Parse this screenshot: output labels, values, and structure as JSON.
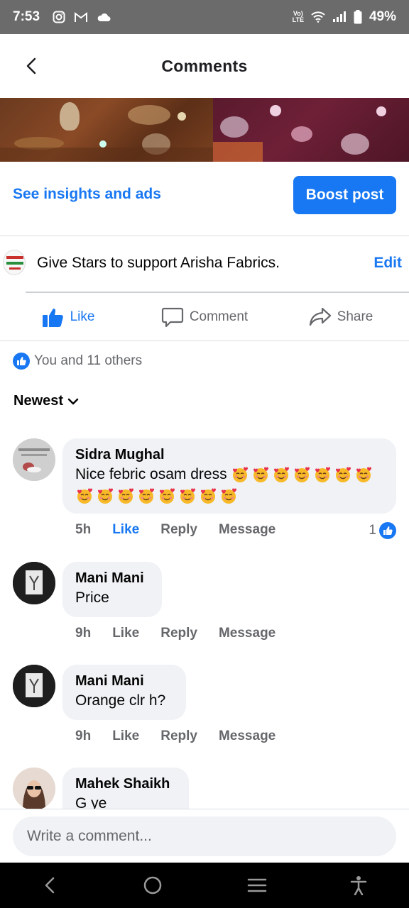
{
  "status_bar": {
    "time": "7:53",
    "battery": "49%",
    "volte_line1": "Vo)",
    "volte_line2": "LTE",
    "icons": [
      "instagram-icon",
      "gmail-icon",
      "cloud-icon",
      "wifi-icon",
      "signal-icon",
      "battery-icon"
    ]
  },
  "header": {
    "title": "Comments"
  },
  "insights": {
    "link_label": "See insights and ads",
    "boost_label": "Boost post"
  },
  "stars": {
    "text": "Give Stars to support Arisha Fabrics.",
    "edit_label": "Edit"
  },
  "actions": {
    "like": "Like",
    "comment": "Comment",
    "share": "Share"
  },
  "reactions": {
    "summary": "You and 11 others"
  },
  "sort": {
    "label": "Newest"
  },
  "comments": [
    {
      "name": "Sidra Mughal",
      "text": "Nice febric osam dress",
      "emoji_count": 15,
      "time": "5h",
      "like": "Like",
      "reply": "Reply",
      "message": "Message",
      "liked": true,
      "reaction_count": "1"
    },
    {
      "name": "Mani Mani",
      "text": "Price",
      "time": "9h",
      "like": "Like",
      "reply": "Reply",
      "message": "Message"
    },
    {
      "name": "Mani Mani",
      "text": "Orange clr h?",
      "time": "9h",
      "like": "Like",
      "reply": "Reply",
      "message": "Message"
    },
    {
      "name": "Mahek Shaikh",
      "text": "G ye"
    }
  ],
  "write": {
    "placeholder": "Write a comment..."
  },
  "colors": {
    "accent": "#1877f2",
    "bubble": "#f0f2f5",
    "secondary_text": "#65676b"
  }
}
